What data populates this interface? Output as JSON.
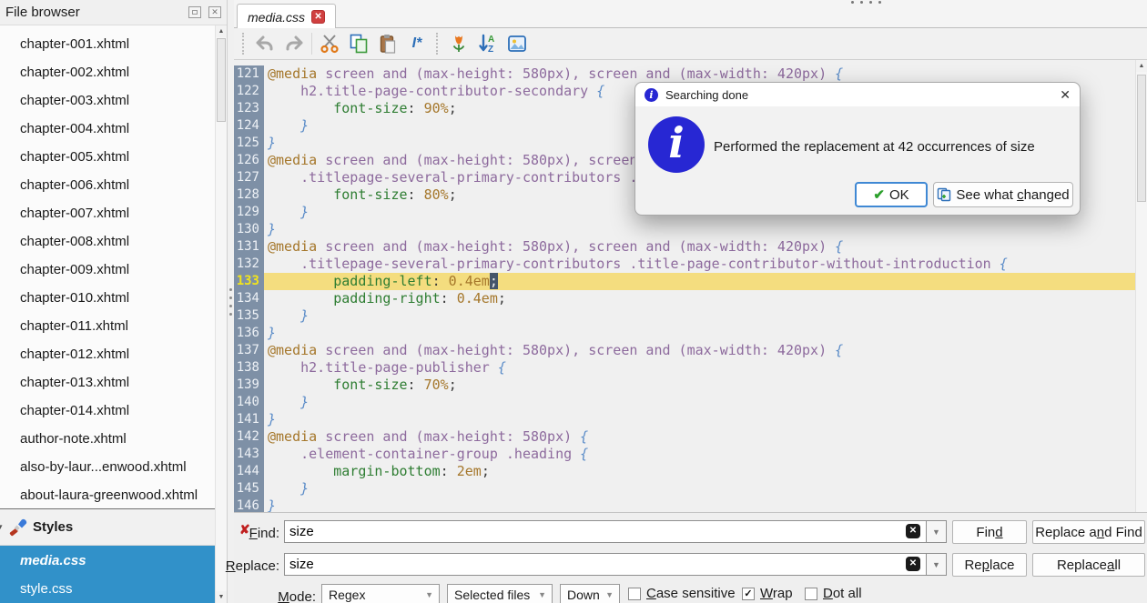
{
  "sidebar": {
    "header": {
      "title": "File browser"
    },
    "files": [
      "chapter-001.xhtml",
      "chapter-002.xhtml",
      "chapter-003.xhtml",
      "chapter-004.xhtml",
      "chapter-005.xhtml",
      "chapter-006.xhtml",
      "chapter-007.xhtml",
      "chapter-008.xhtml",
      "chapter-009.xhtml",
      "chapter-010.xhtml",
      "chapter-011.xhtml",
      "chapter-012.xhtml",
      "chapter-013.xhtml",
      "chapter-014.xhtml",
      "author-note.xhtml",
      "also-by-laur...enwood.xhtml",
      "about-laura-greenwood.xhtml"
    ],
    "styles": {
      "label": "Styles",
      "items": [
        {
          "name": "media.css"
        },
        {
          "name": "style.css"
        }
      ]
    }
  },
  "tab": {
    "label": "media.css"
  },
  "toolbar": {
    "icons": [
      "undo",
      "redo",
      "cut",
      "copy",
      "paste",
      "insert-marker",
      "special-character",
      "sort-az",
      "insert-image"
    ]
  },
  "editor": {
    "lines": [
      {
        "n": 121,
        "toks": [
          [
            "at",
            "@media"
          ],
          [
            "sel",
            " screen and (max-height: 580px), screen and (max-width: 420px) "
          ],
          [
            "brace",
            "{"
          ]
        ]
      },
      {
        "n": 122,
        "toks": [
          [
            "punc",
            "    "
          ],
          [
            "sel",
            "h2.title-page-contributor-secondary "
          ],
          [
            "brace",
            "{"
          ]
        ]
      },
      {
        "n": 123,
        "toks": [
          [
            "punc",
            "        "
          ],
          [
            "prop",
            "font-size"
          ],
          [
            "punc",
            ":"
          ],
          [
            "val",
            " 90%"
          ],
          [
            "punc",
            ";"
          ]
        ]
      },
      {
        "n": 124,
        "toks": [
          [
            "punc",
            "    "
          ],
          [
            "brace",
            "}"
          ]
        ]
      },
      {
        "n": 125,
        "toks": [
          [
            "brace",
            "}"
          ]
        ]
      },
      {
        "n": 126,
        "toks": [
          [
            "at",
            "@media"
          ],
          [
            "sel",
            " screen and (max-height: 580px), screen and (max-width: 420px) "
          ],
          [
            "brace",
            "{"
          ]
        ]
      },
      {
        "n": 127,
        "toks": [
          [
            "punc",
            "    "
          ],
          [
            "sel",
            ".titlepage-several-primary-contributors .title-page-contributor-secondary "
          ],
          [
            "brace",
            "{"
          ]
        ]
      },
      {
        "n": 128,
        "toks": [
          [
            "punc",
            "        "
          ],
          [
            "prop",
            "font-size"
          ],
          [
            "punc",
            ":"
          ],
          [
            "val",
            " 80%"
          ],
          [
            "punc",
            ";"
          ]
        ]
      },
      {
        "n": 129,
        "toks": [
          [
            "punc",
            "    "
          ],
          [
            "brace",
            "}"
          ]
        ]
      },
      {
        "n": 130,
        "toks": [
          [
            "brace",
            "}"
          ]
        ]
      },
      {
        "n": 131,
        "toks": [
          [
            "at",
            "@media"
          ],
          [
            "sel",
            " screen and (max-height: 580px), screen and (max-width: 420px) "
          ],
          [
            "brace",
            "{"
          ]
        ]
      },
      {
        "n": 132,
        "toks": [
          [
            "punc",
            "    "
          ],
          [
            "sel",
            ".titlepage-several-primary-contributors .title-page-contributor-without-introduction "
          ],
          [
            "brace",
            "{"
          ]
        ]
      },
      {
        "n": 133,
        "cur": true,
        "toks": [
          [
            "punc",
            "        "
          ],
          [
            "prop",
            "padding-left"
          ],
          [
            "punc",
            ":"
          ],
          [
            "val",
            " 0.4em"
          ],
          [
            "cursor",
            ";"
          ]
        ]
      },
      {
        "n": 134,
        "toks": [
          [
            "punc",
            "        "
          ],
          [
            "prop",
            "padding-right"
          ],
          [
            "punc",
            ":"
          ],
          [
            "val",
            " 0.4em"
          ],
          [
            "punc",
            ";"
          ]
        ]
      },
      {
        "n": 135,
        "toks": [
          [
            "punc",
            "    "
          ],
          [
            "brace",
            "}"
          ]
        ]
      },
      {
        "n": 136,
        "toks": [
          [
            "brace",
            "}"
          ]
        ]
      },
      {
        "n": 137,
        "toks": [
          [
            "at",
            "@media"
          ],
          [
            "sel",
            " screen and (max-height: 580px), screen and (max-width: 420px) "
          ],
          [
            "brace",
            "{"
          ]
        ]
      },
      {
        "n": 138,
        "toks": [
          [
            "punc",
            "    "
          ],
          [
            "sel",
            "h2.title-page-publisher "
          ],
          [
            "brace",
            "{"
          ]
        ]
      },
      {
        "n": 139,
        "toks": [
          [
            "punc",
            "        "
          ],
          [
            "prop",
            "font-size"
          ],
          [
            "punc",
            ":"
          ],
          [
            "val",
            " 70%"
          ],
          [
            "punc",
            ";"
          ]
        ]
      },
      {
        "n": 140,
        "toks": [
          [
            "punc",
            "    "
          ],
          [
            "brace",
            "}"
          ]
        ]
      },
      {
        "n": 141,
        "toks": [
          [
            "brace",
            "}"
          ]
        ]
      },
      {
        "n": 142,
        "toks": [
          [
            "at",
            "@media"
          ],
          [
            "sel",
            " screen and (max-height: 580px) "
          ],
          [
            "brace",
            "{"
          ]
        ]
      },
      {
        "n": 143,
        "toks": [
          [
            "punc",
            "    "
          ],
          [
            "sel",
            ".element-container-group .heading "
          ],
          [
            "brace",
            "{"
          ]
        ]
      },
      {
        "n": 144,
        "toks": [
          [
            "punc",
            "        "
          ],
          [
            "prop",
            "margin-bottom"
          ],
          [
            "punc",
            ":"
          ],
          [
            "val",
            " 2em"
          ],
          [
            "punc",
            ";"
          ]
        ]
      },
      {
        "n": 145,
        "toks": [
          [
            "punc",
            "    "
          ],
          [
            "brace",
            "}"
          ]
        ]
      },
      {
        "n": 146,
        "toks": [
          [
            "brace",
            "}"
          ]
        ]
      }
    ]
  },
  "dialog": {
    "title": "Searching done",
    "message": "Performed the replacement at 42 occurrences of size",
    "ok_button": {
      "text": "OK",
      "u": -1
    },
    "see_button": {
      "text": "See what changed",
      "u": 9
    }
  },
  "find": {
    "find_label": {
      "text": "Find:",
      "u": 0
    },
    "replace_label": {
      "text": "Replace:",
      "u": 0
    },
    "mode_label": {
      "text": "Mode:",
      "u": 0
    },
    "find_value": "size",
    "replace_value": "size",
    "buttons": {
      "find": {
        "text": "Find",
        "u": 3
      },
      "replace_and_find": {
        "text": "Replace and Find",
        "u": 9
      },
      "replace": {
        "text": "Replace",
        "u": 2
      },
      "replace_all": {
        "text": "Replace all",
        "u": 8
      }
    },
    "combos": {
      "mode": "Regex",
      "scope": "Selected files",
      "direction": "Down"
    },
    "checkboxes": [
      {
        "text": "Case sensitive",
        "u": 0,
        "checked": false
      },
      {
        "text": "Wrap",
        "u": 0,
        "checked": true
      },
      {
        "text": "Dot all",
        "u": 0,
        "checked": false
      }
    ]
  },
  "colors": {
    "selection_blue": "#3191c9",
    "current_line_yellow": "#f4dd7f",
    "gutter_slate": "#7e90a6",
    "info_blue": "#2727d3",
    "tab_close_red": "#d04040"
  }
}
